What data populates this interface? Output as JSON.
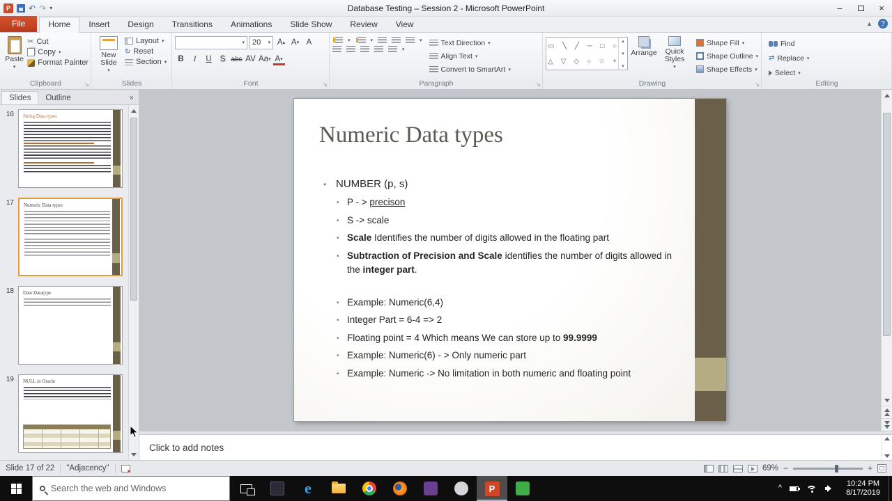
{
  "titlebar": {
    "title": "Database Testing – Session 2 - Microsoft PowerPoint"
  },
  "ribbon_tabs": [
    "File",
    "Home",
    "Insert",
    "Design",
    "Transitions",
    "Animations",
    "Slide Show",
    "Review",
    "View"
  ],
  "ribbon": {
    "clipboard": {
      "label": "Clipboard",
      "paste": "Paste",
      "cut": "Cut",
      "copy": "Copy",
      "format_painter": "Format Painter"
    },
    "slides": {
      "label": "Slides",
      "new_slide": "New Slide",
      "layout": "Layout",
      "reset": "Reset",
      "section": "Section"
    },
    "font": {
      "label": "Font",
      "name_value": "",
      "size_value": "20"
    },
    "paragraph": {
      "label": "Paragraph",
      "text_direction": "Text Direction",
      "align_text": "Align Text",
      "convert_smartart": "Convert to SmartArt"
    },
    "drawing": {
      "label": "Drawing",
      "arrange": "Arrange",
      "quick_styles": "Quick Styles",
      "shape_fill": "Shape Fill",
      "shape_outline": "Shape Outline",
      "shape_effects": "Shape Effects"
    },
    "editing": {
      "label": "Editing",
      "find": "Find",
      "replace": "Replace",
      "select": "Select"
    }
  },
  "panel": {
    "tab_slides": "Slides",
    "tab_outline": "Outline",
    "thumbnails": [
      {
        "number": "16",
        "title": "String Data types"
      },
      {
        "number": "17",
        "title": "Numeric Data types"
      },
      {
        "number": "18",
        "title": "Date Datatype"
      },
      {
        "number": "19",
        "title": "NULL in Oracle"
      }
    ]
  },
  "slide": {
    "title": "Numeric Data types",
    "bullets": [
      {
        "level": 1,
        "runs": [
          {
            "text": "NUMBER (p, s)"
          }
        ]
      },
      {
        "level": 2,
        "runs": [
          {
            "text": "P - > "
          },
          {
            "text": "precison",
            "underline": true
          }
        ]
      },
      {
        "level": 2,
        "runs": [
          {
            "text": "S -> scale"
          }
        ]
      },
      {
        "level": 2,
        "runs": [
          {
            "text": "Scale",
            "bold": true
          },
          {
            "text": " Identifies the number of digits allowed in the floating part"
          }
        ]
      },
      {
        "level": 2,
        "runs": [
          {
            "text": "Subtraction of Precision and Scale",
            "bold": true
          },
          {
            "text": " identifies the number of digits allowed in the "
          },
          {
            "text": "integer part",
            "bold": true
          },
          {
            "text": "."
          }
        ]
      },
      {
        "level": 2,
        "blank": true,
        "runs": []
      },
      {
        "level": 2,
        "runs": [
          {
            "text": "Example: Numeric(6,4)"
          }
        ]
      },
      {
        "level": 2,
        "runs": [
          {
            "text": "Integer Part = 6-4 => 2"
          }
        ]
      },
      {
        "level": 2,
        "runs": [
          {
            "text": "Floating point = 4 Which means We can store up to "
          },
          {
            "text": "99.9999",
            "bold": true
          }
        ]
      },
      {
        "level": 2,
        "runs": [
          {
            "text": "Example: Numeric(6) - > Only numeric part"
          }
        ]
      },
      {
        "level": 2,
        "runs": [
          {
            "text": "Example: Numeric -> No limitation in both numeric and floating point"
          }
        ]
      }
    ]
  },
  "notes": {
    "placeholder": "Click to add notes"
  },
  "status": {
    "slide_info": "Slide 17 of 22",
    "theme": "\"Adjacency\"",
    "zoom": "69%"
  },
  "taskbar": {
    "search_placeholder": "Search the web and Windows",
    "time": "10:24 PM",
    "date": "8/17/2019"
  }
}
